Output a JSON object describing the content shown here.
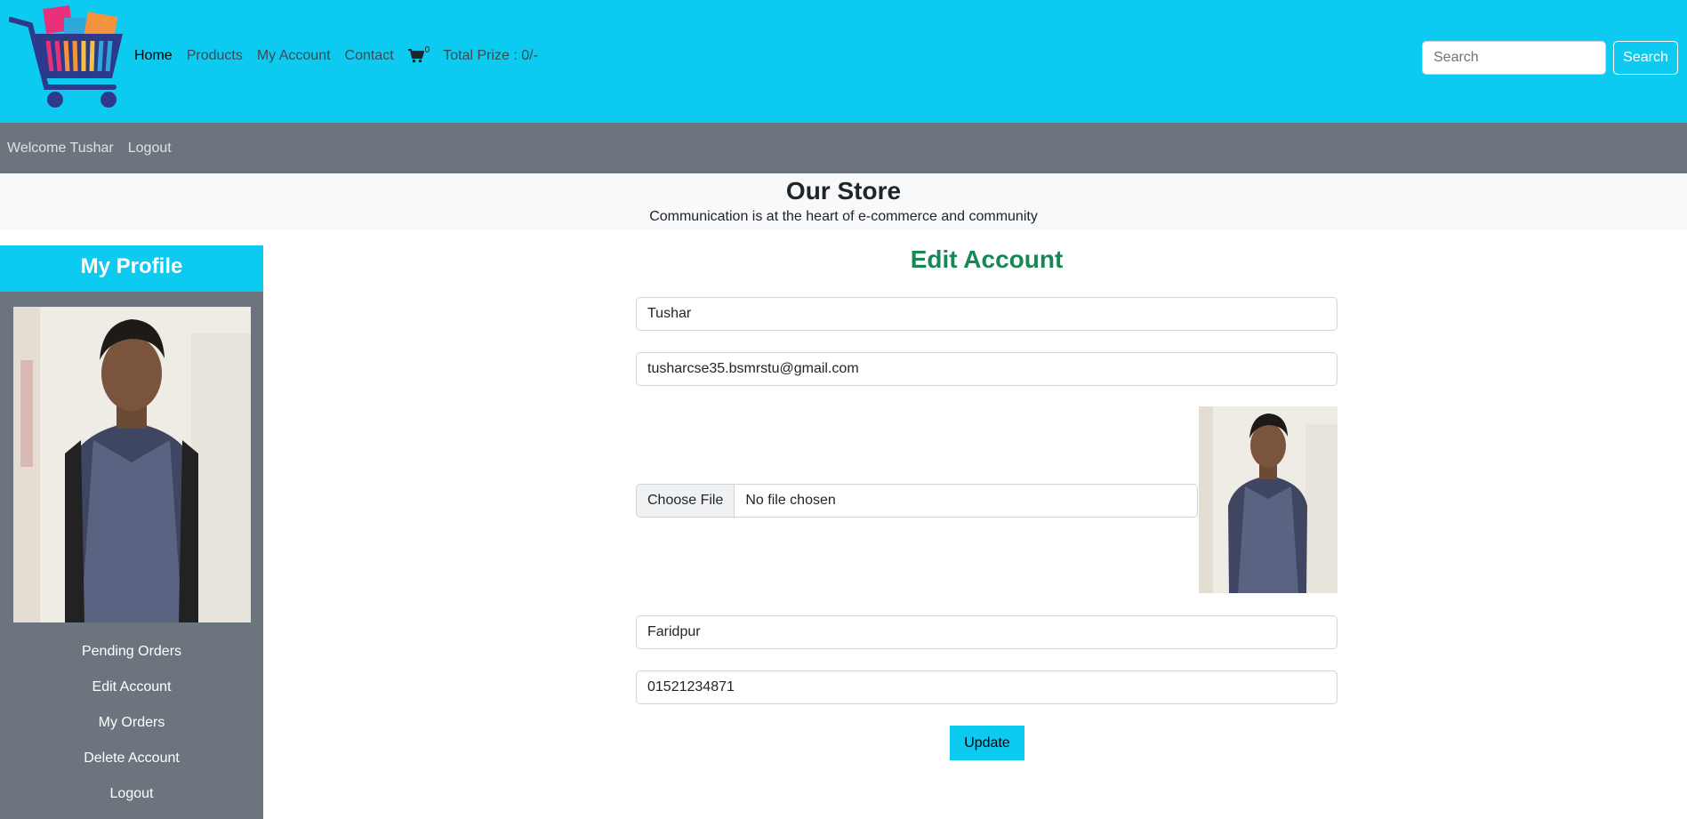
{
  "nav": {
    "links": [
      "Home",
      "Products",
      "My Account",
      "Contact"
    ],
    "cart_count": "0",
    "total_prize": "Total Prize : 0/-",
    "search_placeholder": "Search",
    "search_button": "Search"
  },
  "subnav": {
    "welcome": "Welcome Tushar",
    "logout": "Logout"
  },
  "hero": {
    "title": "Our Store",
    "tagline": "Communication is at the heart of e-commerce and community"
  },
  "sidebar": {
    "heading": "My Profile",
    "menu": [
      "Pending Orders",
      "Edit Account",
      "My Orders",
      "Delete Account",
      "Logout"
    ]
  },
  "form": {
    "title": "Edit Account",
    "username": "Tushar",
    "email": "tusharcse35.bsmrstu@gmail.com",
    "file_button": "Choose File",
    "file_status": "No file chosen",
    "address": "Faridpur",
    "phone": "01521234871",
    "submit": "Update"
  },
  "colors": {
    "navbar": "#0dcaf0",
    "secondary": "#6c757d",
    "title_green": "#198754"
  },
  "icons": [
    "cart-logo",
    "cart-icon"
  ]
}
